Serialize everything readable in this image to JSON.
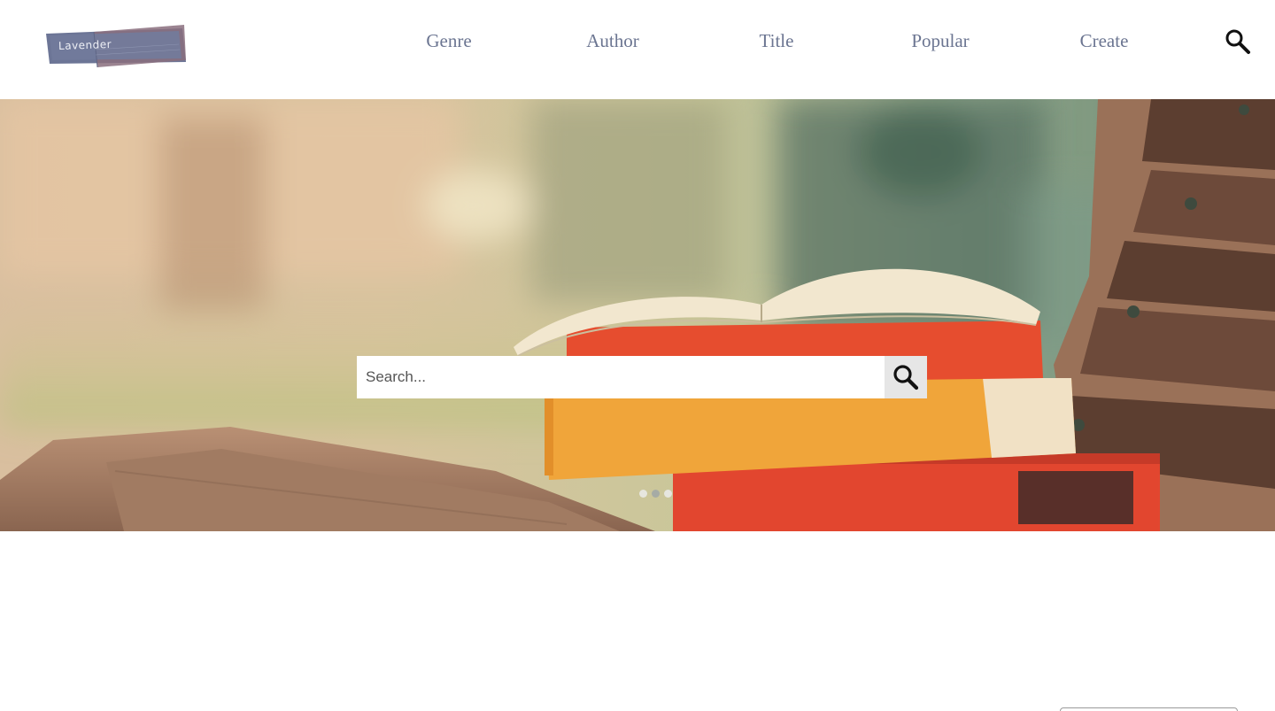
{
  "brand": {
    "logo_text": "Lavender",
    "primary_color": "#6c7596",
    "secondary_color": "#8a6f7e"
  },
  "nav": {
    "items": [
      {
        "label": "Genre"
      },
      {
        "label": "Author"
      },
      {
        "label": "Title"
      },
      {
        "label": "Popular"
      },
      {
        "label": "Create"
      }
    ],
    "search_icon": "search-icon",
    "text_color": "#6b7591"
  },
  "hero": {
    "search": {
      "placeholder": "Search...",
      "value": "",
      "button_icon": "search-icon"
    },
    "carousel": {
      "slide_count": 3,
      "active_index": 1
    }
  }
}
